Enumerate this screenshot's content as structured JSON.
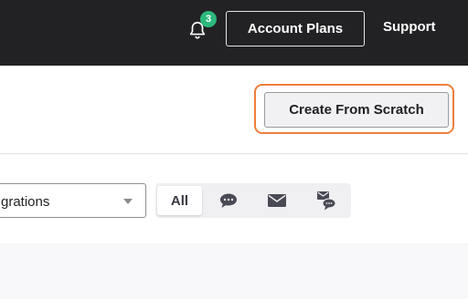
{
  "topbar": {
    "notifications": {
      "icon": "bell-icon",
      "count": "3",
      "badge_color": "#2db87d"
    },
    "account_plans_label": "Account Plans",
    "support_label": "Support"
  },
  "header": {
    "create_label": "Create From Scratch",
    "highlight_color": "#f07f3c"
  },
  "filters": {
    "select_value": "grations",
    "channel_tabs": [
      {
        "label": "All",
        "selected": true
      },
      {
        "icon": "chat-bubble-icon"
      },
      {
        "icon": "envelope-icon"
      },
      {
        "icon": "email-and-chat-icon"
      }
    ]
  }
}
